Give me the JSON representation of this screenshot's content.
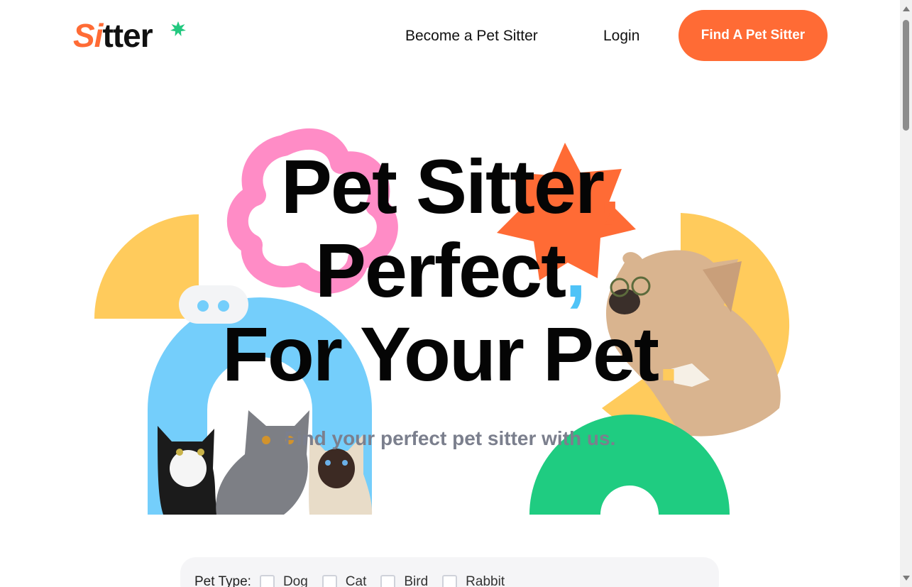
{
  "brand": {
    "logo_si": "Si",
    "logo_rest": "tter",
    "accent": "#ff6b35",
    "star_color": "#22c87f"
  },
  "nav": {
    "become_label": "Become a Pet Sitter",
    "login_label": "Login",
    "cta_label": "Find A Pet Sitter"
  },
  "hero": {
    "line1": "Pet Sitter",
    "line2": "Perfect",
    "line3": "For Your Pet",
    "comma": ",",
    "period": ".",
    "subtitle": "Find your perfect pet sitter with us."
  },
  "filter": {
    "label": "Pet Type:",
    "options": [
      {
        "label": "Dog",
        "checked": false
      },
      {
        "label": "Cat",
        "checked": false
      },
      {
        "label": "Bird",
        "checked": false
      },
      {
        "label": "Rabbit",
        "checked": false
      }
    ]
  },
  "colors": {
    "pink": "#ff8cc6",
    "orange": "#ff6b35",
    "yellow": "#ffcb5c",
    "blue": "#74cefb",
    "green": "#1fcc81"
  },
  "icons": {
    "logo_star": "star-burst-icon",
    "scroll_up": "scroll-up-arrow-icon",
    "scroll_down": "scroll-down-arrow-icon"
  }
}
